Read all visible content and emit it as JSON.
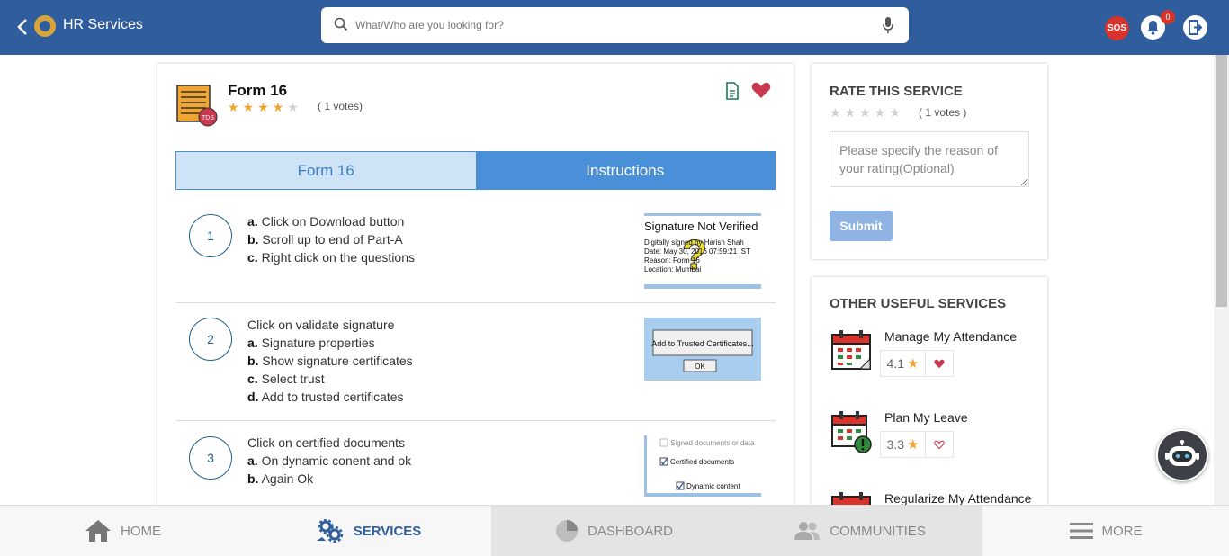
{
  "header": {
    "app_title": "HR Services",
    "search_placeholder": "What/Who are you looking for?",
    "sos_label": "SOS",
    "notification_count": "0"
  },
  "form": {
    "title": "Form 16",
    "rating": 4,
    "votes": "( 1 votes)",
    "icon_badge": "TDS",
    "tabs": [
      "Form 16",
      "Instructions"
    ],
    "active_tab": "Instructions"
  },
  "steps": [
    {
      "number": "1",
      "lines": [
        {
          "prefix": "a.",
          "text": "Click on Download button"
        },
        {
          "prefix": "b.",
          "text": "Scroll up to end of Part-A"
        },
        {
          "prefix": "c.",
          "text": "Right click on the questions"
        }
      ],
      "image_text": {
        "title": "Signature Not Verified",
        "lines": [
          "Digitally signed by Harish Shah",
          "Date: May 30, 2016 07:59:21 IST",
          "Reason: Form 16",
          "Location: Mumbai"
        ]
      }
    },
    {
      "number": "2",
      "lines": [
        {
          "prefix": "",
          "text": "Click on validate signature"
        },
        {
          "prefix": "a.",
          "text": "Signature properties"
        },
        {
          "prefix": "b.",
          "text": "Show signature certificates"
        },
        {
          "prefix": "c.",
          "text": "Select trust"
        },
        {
          "prefix": "d.",
          "text": "Add to trusted certificates"
        }
      ],
      "image_text": {
        "button": "Add to Trusted Certificates...",
        "ok": "OK"
      }
    },
    {
      "number": "3",
      "lines": [
        {
          "prefix": "",
          "text": "Click on certified documents"
        },
        {
          "prefix": "a.",
          "text": "On dynamic conent and ok"
        },
        {
          "prefix": "b.",
          "text": "Again Ok"
        }
      ],
      "image_text": {
        "lines": [
          "Signed documents or data",
          "Certified documents",
          "Dynamic content"
        ]
      }
    }
  ],
  "rate": {
    "heading": "RATE THIS SERVICE",
    "votes": "( 1 votes )",
    "placeholder": "Please specify the reason of your rating(Optional)",
    "submit_label": "Submit"
  },
  "other": {
    "heading": "OTHER USEFUL SERVICES",
    "services": [
      {
        "name": "Manage My Attendance",
        "rating": "4.1",
        "favorited": true
      },
      {
        "name": "Plan My Leave",
        "rating": "3.3",
        "favorited": false
      },
      {
        "name": "Regularize My Attendance",
        "rating": "",
        "favorited": false
      }
    ]
  },
  "bottom_nav": {
    "home": "HOME",
    "services": "SERVICES",
    "dashboard": "DASHBOARD",
    "communities": "COMMUNITIES",
    "more": "MORE",
    "active": "SERVICES"
  },
  "colors": {
    "header_bg": "#2f5d9e",
    "accent_blue": "#4a90d9",
    "star": "#f0a531",
    "favorite": "#c8394f",
    "sos": "#d9342b"
  }
}
